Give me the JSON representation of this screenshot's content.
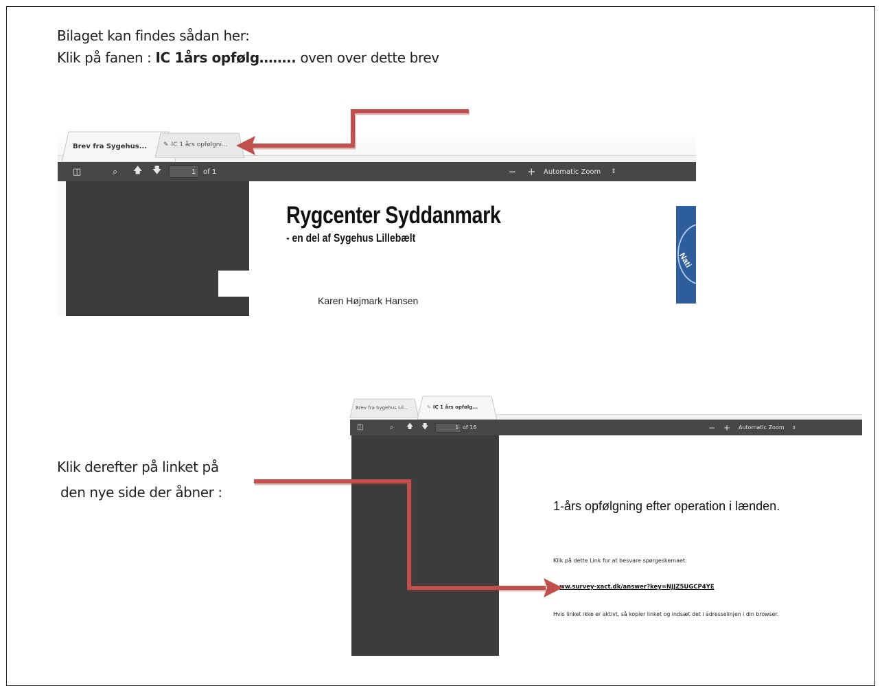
{
  "instructions": {
    "line1": "Bilaget kan findes sådan her:",
    "line2_prefix": "Klik på fanen : ",
    "line2_bold": "IC 1års opfølg……..",
    "line2_suffix": " oven over dette brev",
    "step2_line1": "Klik derefter på linket på",
    "step2_line2": "den nye side der åbner :"
  },
  "screenshot1": {
    "tabs": [
      {
        "label": "Brev fra Sygehus...",
        "active": true
      },
      {
        "label": "IC 1 års opfølgni...",
        "active": false,
        "icon": "paperclip-icon"
      }
    ],
    "toolbar": {
      "page_current": "1",
      "page_total": "of 1",
      "zoom_minus": "−",
      "zoom_plus": "+",
      "zoom_label": "Automatic Zoom",
      "zoom_arrow": "⇕"
    },
    "document": {
      "title": "Rygcenter Syddanmark",
      "subtitle": "- en del af Sygehus Lillebælt",
      "recipient": "Karen Højmark Hansen",
      "logo_text": "Nati"
    }
  },
  "screenshot2": {
    "tabs": [
      {
        "label": "Brev fra Sygehus Lil...",
        "active": false
      },
      {
        "label": "IC 1 års opfølg...",
        "active": true,
        "icon": "paperclip-icon"
      }
    ],
    "toolbar": {
      "page_current": "1",
      "page_total": "of 16",
      "zoom_minus": "−",
      "zoom_plus": "+",
      "zoom_label": "Automatic Zoom",
      "zoom_arrow": "⇕"
    },
    "document": {
      "heading": "1-års opfølgning efter operation i lænden.",
      "instruction": "Klik på dette Link for at besvare spørgeskemaet:",
      "link": "ww.survey-xact.dk/answer?key=NJJZ5UGCP4YE",
      "note": "Hvis linket ikke er aktivt, så kopier linket og indsæt det i adresselinjen i din browser."
    }
  },
  "colors": {
    "arrow": "#c0504d",
    "toolbar": "#474747",
    "sidebar": "#3c3c3c"
  }
}
